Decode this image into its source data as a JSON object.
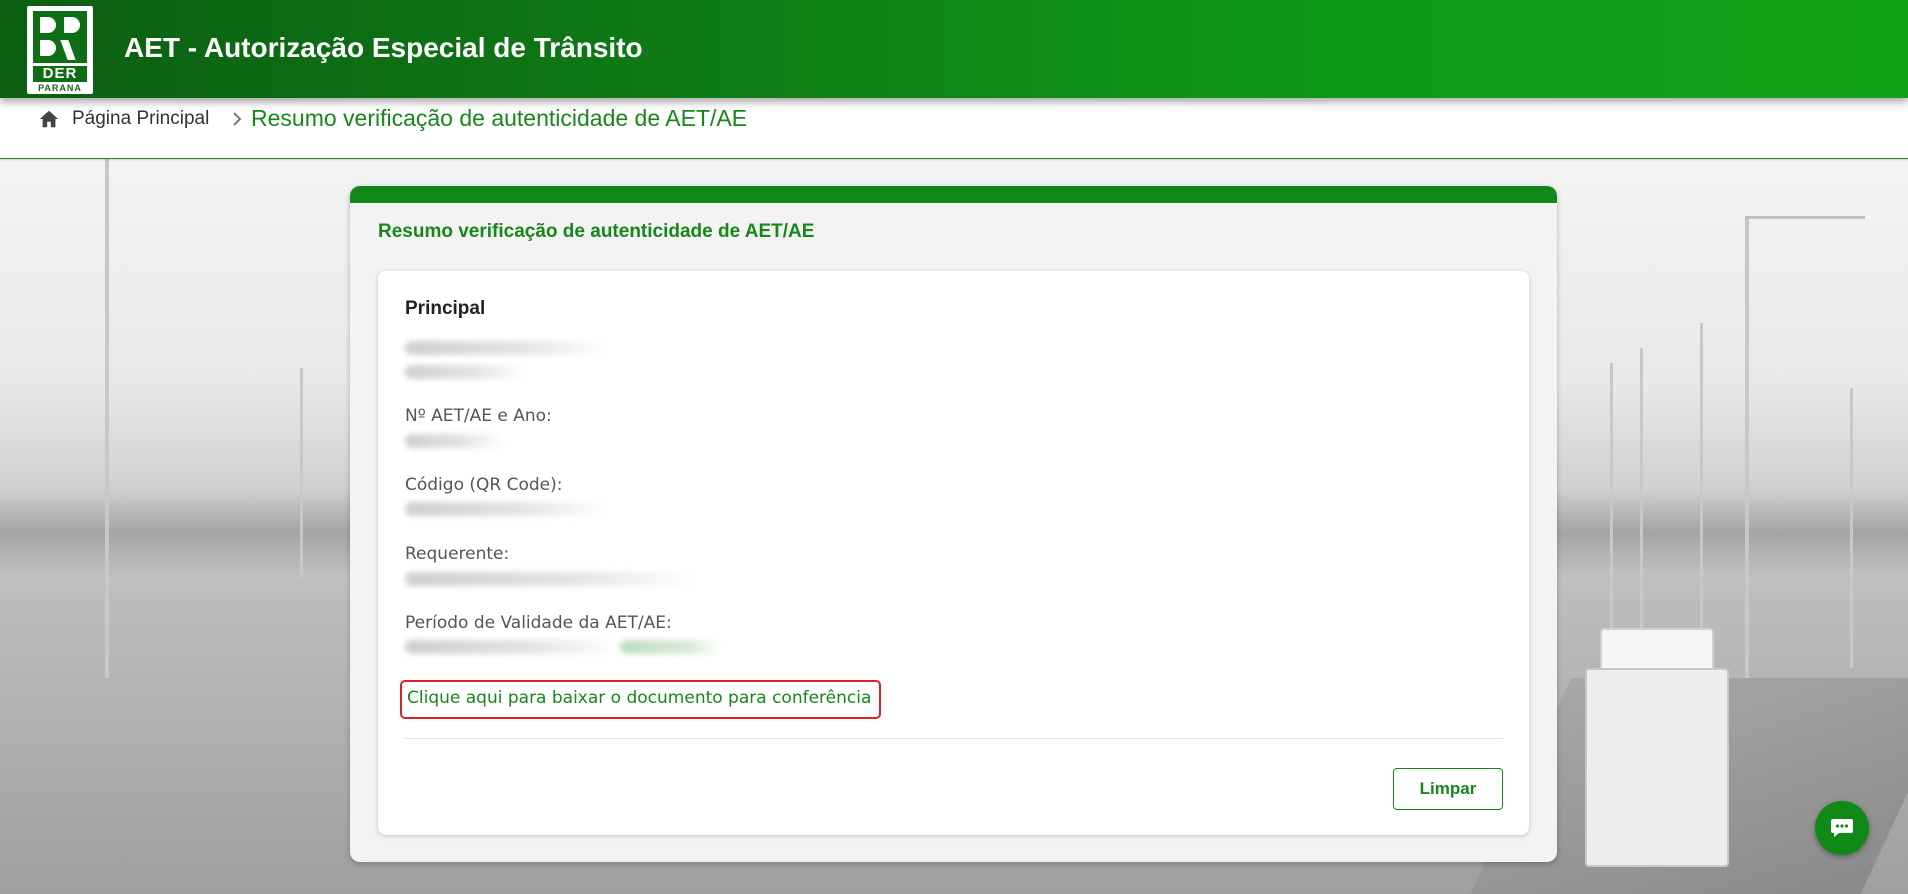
{
  "header": {
    "app_title": "AET - Autorização Especial de Trânsito",
    "logo": {
      "main_text": "DER",
      "sub_text": "PARANA"
    }
  },
  "breadcrumb": {
    "home_label": "Página Principal",
    "current": "Resumo verificação de autenticidade de AET/AE"
  },
  "panel": {
    "title": "Resumo verificação de autenticidade de AET/AE",
    "section_title": "Principal",
    "fields": [
      {
        "label": "Nº AET/AE e Ano:"
      },
      {
        "label": "Código (QR Code):"
      },
      {
        "label": "Requerente:"
      },
      {
        "label": "Período de Validade da AET/AE:"
      }
    ],
    "download_link": "Clique aqui para baixar o documento para conferência",
    "clear_button": "Limpar"
  },
  "colors": {
    "brand_green": "#16881a",
    "header_dark": "#0b5e12",
    "header_light": "#10a218",
    "highlight_red": "#e02020"
  },
  "icons": {
    "home": "home-icon",
    "separator": "chevron-right-icon",
    "chat": "chat-bubble-icon"
  }
}
